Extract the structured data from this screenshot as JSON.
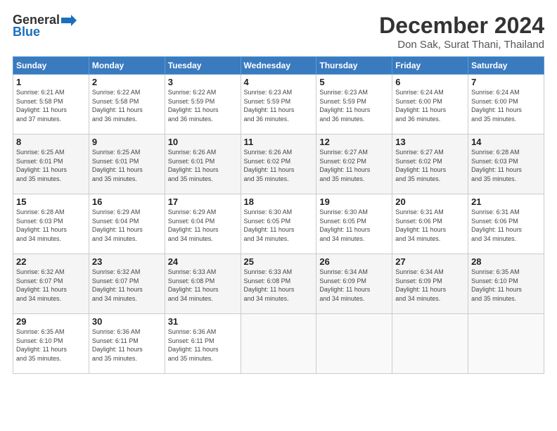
{
  "logo": {
    "general": "General",
    "blue": "Blue"
  },
  "title": "December 2024",
  "subtitle": "Don Sak, Surat Thani, Thailand",
  "days_of_week": [
    "Sunday",
    "Monday",
    "Tuesday",
    "Wednesday",
    "Thursday",
    "Friday",
    "Saturday"
  ],
  "weeks": [
    [
      {
        "day": "1",
        "info": "Sunrise: 6:21 AM\nSunset: 5:58 PM\nDaylight: 11 hours\nand 37 minutes."
      },
      {
        "day": "2",
        "info": "Sunrise: 6:22 AM\nSunset: 5:58 PM\nDaylight: 11 hours\nand 36 minutes."
      },
      {
        "day": "3",
        "info": "Sunrise: 6:22 AM\nSunset: 5:59 PM\nDaylight: 11 hours\nand 36 minutes."
      },
      {
        "day": "4",
        "info": "Sunrise: 6:23 AM\nSunset: 5:59 PM\nDaylight: 11 hours\nand 36 minutes."
      },
      {
        "day": "5",
        "info": "Sunrise: 6:23 AM\nSunset: 5:59 PM\nDaylight: 11 hours\nand 36 minutes."
      },
      {
        "day": "6",
        "info": "Sunrise: 6:24 AM\nSunset: 6:00 PM\nDaylight: 11 hours\nand 36 minutes."
      },
      {
        "day": "7",
        "info": "Sunrise: 6:24 AM\nSunset: 6:00 PM\nDaylight: 11 hours\nand 35 minutes."
      }
    ],
    [
      {
        "day": "8",
        "info": "Sunrise: 6:25 AM\nSunset: 6:01 PM\nDaylight: 11 hours\nand 35 minutes."
      },
      {
        "day": "9",
        "info": "Sunrise: 6:25 AM\nSunset: 6:01 PM\nDaylight: 11 hours\nand 35 minutes."
      },
      {
        "day": "10",
        "info": "Sunrise: 6:26 AM\nSunset: 6:01 PM\nDaylight: 11 hours\nand 35 minutes."
      },
      {
        "day": "11",
        "info": "Sunrise: 6:26 AM\nSunset: 6:02 PM\nDaylight: 11 hours\nand 35 minutes."
      },
      {
        "day": "12",
        "info": "Sunrise: 6:27 AM\nSunset: 6:02 PM\nDaylight: 11 hours\nand 35 minutes."
      },
      {
        "day": "13",
        "info": "Sunrise: 6:27 AM\nSunset: 6:02 PM\nDaylight: 11 hours\nand 35 minutes."
      },
      {
        "day": "14",
        "info": "Sunrise: 6:28 AM\nSunset: 6:03 PM\nDaylight: 11 hours\nand 35 minutes."
      }
    ],
    [
      {
        "day": "15",
        "info": "Sunrise: 6:28 AM\nSunset: 6:03 PM\nDaylight: 11 hours\nand 34 minutes."
      },
      {
        "day": "16",
        "info": "Sunrise: 6:29 AM\nSunset: 6:04 PM\nDaylight: 11 hours\nand 34 minutes."
      },
      {
        "day": "17",
        "info": "Sunrise: 6:29 AM\nSunset: 6:04 PM\nDaylight: 11 hours\nand 34 minutes."
      },
      {
        "day": "18",
        "info": "Sunrise: 6:30 AM\nSunset: 6:05 PM\nDaylight: 11 hours\nand 34 minutes."
      },
      {
        "day": "19",
        "info": "Sunrise: 6:30 AM\nSunset: 6:05 PM\nDaylight: 11 hours\nand 34 minutes."
      },
      {
        "day": "20",
        "info": "Sunrise: 6:31 AM\nSunset: 6:06 PM\nDaylight: 11 hours\nand 34 minutes."
      },
      {
        "day": "21",
        "info": "Sunrise: 6:31 AM\nSunset: 6:06 PM\nDaylight: 11 hours\nand 34 minutes."
      }
    ],
    [
      {
        "day": "22",
        "info": "Sunrise: 6:32 AM\nSunset: 6:07 PM\nDaylight: 11 hours\nand 34 minutes."
      },
      {
        "day": "23",
        "info": "Sunrise: 6:32 AM\nSunset: 6:07 PM\nDaylight: 11 hours\nand 34 minutes."
      },
      {
        "day": "24",
        "info": "Sunrise: 6:33 AM\nSunset: 6:08 PM\nDaylight: 11 hours\nand 34 minutes."
      },
      {
        "day": "25",
        "info": "Sunrise: 6:33 AM\nSunset: 6:08 PM\nDaylight: 11 hours\nand 34 minutes."
      },
      {
        "day": "26",
        "info": "Sunrise: 6:34 AM\nSunset: 6:09 PM\nDaylight: 11 hours\nand 34 minutes."
      },
      {
        "day": "27",
        "info": "Sunrise: 6:34 AM\nSunset: 6:09 PM\nDaylight: 11 hours\nand 34 minutes."
      },
      {
        "day": "28",
        "info": "Sunrise: 6:35 AM\nSunset: 6:10 PM\nDaylight: 11 hours\nand 35 minutes."
      }
    ],
    [
      {
        "day": "29",
        "info": "Sunrise: 6:35 AM\nSunset: 6:10 PM\nDaylight: 11 hours\nand 35 minutes."
      },
      {
        "day": "30",
        "info": "Sunrise: 6:36 AM\nSunset: 6:11 PM\nDaylight: 11 hours\nand 35 minutes."
      },
      {
        "day": "31",
        "info": "Sunrise: 6:36 AM\nSunset: 6:11 PM\nDaylight: 11 hours\nand 35 minutes."
      },
      null,
      null,
      null,
      null
    ]
  ]
}
